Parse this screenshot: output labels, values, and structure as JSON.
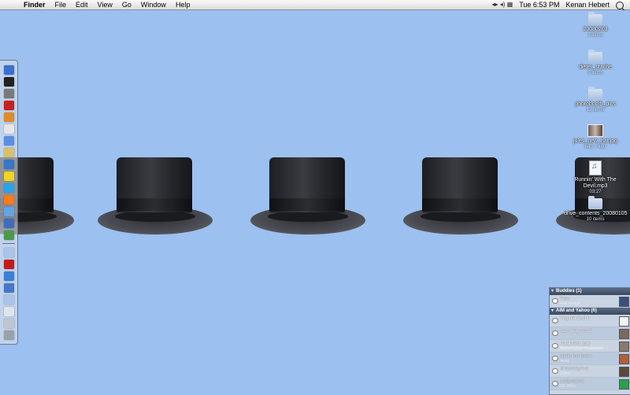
{
  "menubar": {
    "apple_icon": "apple-icon",
    "menus": [
      "Finder",
      "File",
      "Edit",
      "View",
      "Go",
      "Window",
      "Help"
    ],
    "status_glyph": "◂▸ ◂) ▦",
    "clock": "Tue 6:53 PM",
    "user": "Kenan Hebert"
  },
  "desktop": {
    "items": [
      {
        "name": "20080203",
        "sub": "3 items",
        "kind": "folder"
      },
      {
        "name": "dieter_stache",
        "sub": "9 items",
        "kind": "folder"
      },
      {
        "name": "photobooth_pics",
        "sub": "12 items",
        "kind": "folder"
      },
      {
        "name": "jules_new_hat.jpg",
        "sub": "640 × 480",
        "kind": "photo"
      },
      {
        "name": "Runnin' With The Devil.mp3",
        "sub": "03:27",
        "kind": "mp3"
      },
      {
        "name": "drive_contents_20080105",
        "sub": "10 items",
        "kind": "folder"
      }
    ]
  },
  "buddy_list": {
    "groups": [
      {
        "title": "Buddies (1)",
        "buddies": [
          {
            "name": "Pam",
            "status": "eow churne",
            "idle": true,
            "icon_color": "#3a4f7a"
          }
        ]
      },
      {
        "title": "AIM and Yahoo (6)",
        "buddies": [
          {
            "name": "Virginia Grubb",
            "status": "",
            "idle": false,
            "icon_color": "#f3f3f3"
          },
          {
            "name": "I am very metal",
            "status": "",
            "idle": false,
            "icon_color": "#7a6a5a"
          },
          {
            "name": "wizardshungry",
            "status": "Motherfucker=Redeemer-...",
            "idle": false,
            "icon_color": "#8a7a6a"
          },
          {
            "name": "spain bankston",
            "status": "Away",
            "idle": true,
            "icon_color": "#b0603a"
          },
          {
            "name": "MotorwayAve",
            "status": "(13m)",
            "idle": true,
            "icon_color": "#5a4a3a"
          },
          {
            "name": "sextymyers",
            "status": "(1h 29m)",
            "idle": true,
            "icon_color": "#2aa04a"
          }
        ]
      }
    ]
  },
  "dock": {
    "icons": [
      "finder-icon",
      "terminal-icon",
      "system-preferences-icon",
      "acrobat-icon",
      "photo-app-icon",
      "textedit-icon",
      "ical-icon",
      "preview-icon",
      "network-icon",
      "adium-icon",
      "skype-icon",
      "firefox-icon",
      "safari-icon",
      "app-icon",
      "itunes-icon",
      "folder-icon",
      "adobe-icon",
      "font-app-icon",
      "u-app-icon",
      "documents-folder-icon",
      "downloads-stack-icon",
      "trash-icon"
    ]
  },
  "colors": {
    "desktop_bg": "#9cc0ef",
    "menubar_bg": "#ececec"
  }
}
